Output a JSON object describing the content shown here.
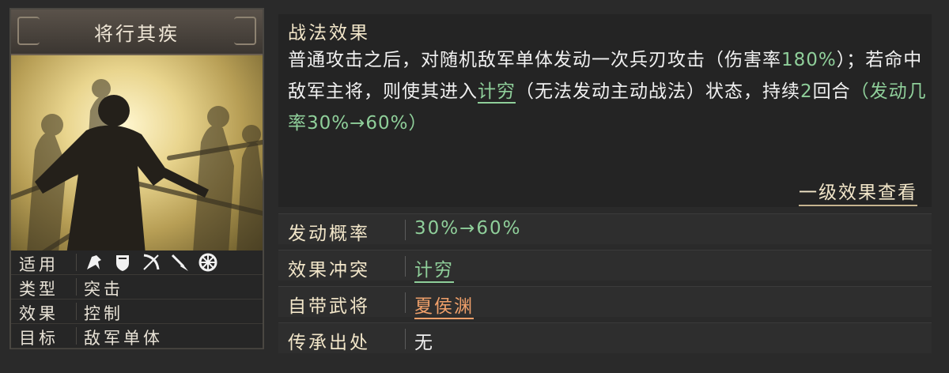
{
  "skill_card": {
    "title": "将行其疾",
    "properties": {
      "applicable_label": "适用",
      "troop_icons": [
        "cavalry-icon",
        "shield-icon",
        "bow-icon",
        "spear-icon",
        "siege-wheel-icon"
      ],
      "type_label": "类型",
      "type_value": "突击",
      "effect_label": "效果",
      "effect_value": "控制",
      "target_label": "目标",
      "target_value": "敌军单体"
    }
  },
  "effect": {
    "header": "战法效果",
    "parts": [
      "普通攻击之后，对随机敌军单体发动一次兵刃攻击（伤害率",
      "180%",
      "）；若命中敌军主将，则使其进入",
      "计穷",
      "（无法发动主动战法）状态，持续",
      "2",
      "回合",
      "（发动几率30%→60%）"
    ],
    "view_more": "一级效果查看"
  },
  "stats": {
    "trigger_rate_label": "发动概率",
    "trigger_rate_value": "30%→60%",
    "conflict_label": "效果冲突",
    "conflict_value": "计穷",
    "general_label": "自带武将",
    "general_value": "夏侯渊",
    "source_label": "传承出处",
    "source_value": "无"
  },
  "colors": {
    "accent_green": "#8fcf9a",
    "accent_orange": "#f0a06a",
    "header_cream": "#f2e6c9"
  }
}
